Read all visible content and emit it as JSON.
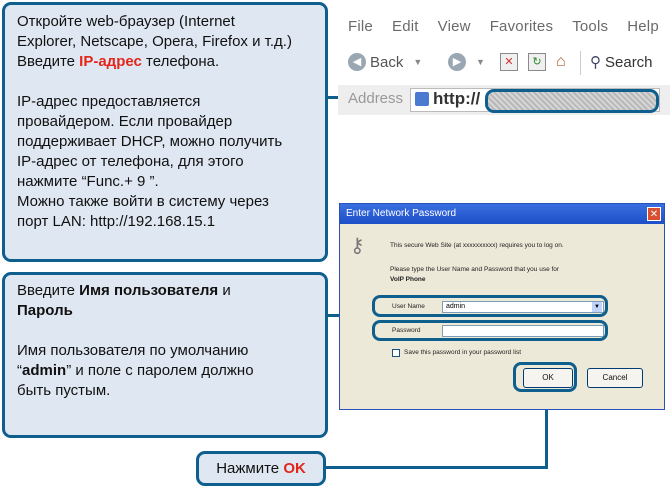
{
  "callouts": {
    "browser": {
      "line1": "Откройте web-браузер (Internet",
      "line2": "Explorer, Netscape, Opera, Firefox и т.д.)",
      "line3_pre": "Введите ",
      "line3_red": "IP-адрес",
      "line3_post": " телефона.",
      "p2_l1": "IP-адрес предоставляется",
      "p2_l2": "провайдером. Если провайдер",
      "p2_l3": "поддерживает DHCP,  можно получить",
      "p2_l4": "IP-адрес от телефона, для этого",
      "p2_l5": "нажмите “Func.+ 9 ”.",
      "p2_l6": "Можно также войти в систему через",
      "p2_l7": "порт LAN:  http://192.168.15.1"
    },
    "credentials": {
      "l1_pre": "Введите ",
      "l1_bold": "Имя пользователя",
      "l1_post": " и",
      "l2_bold": "Пароль",
      "p2_l1": "Имя пользователя по умолчанию",
      "p2_l2_pre": "“",
      "p2_l2_bold": "admin",
      "p2_l2_post": "” и поле с паролем должно",
      "p2_l3": "быть пустым."
    },
    "ok": {
      "pre": "Нажмите ",
      "red": "OK"
    }
  },
  "browser": {
    "menu": [
      "File",
      "Edit",
      "View",
      "Favorites",
      "Tools",
      "Help"
    ],
    "toolbar": {
      "back": "Back",
      "search": "Search"
    },
    "address_label": "Address",
    "address_text": "http://"
  },
  "dialog": {
    "title": "Enter Network Password",
    "close": "✕",
    "msg1": "This secure Web Site (at xxxxxxxxxx) requires you to log on.",
    "msg2": "Please type the User Name and Password that you use for",
    "msg3": "VoIP Phone",
    "username_label": "User Name",
    "username_value": "admin",
    "password_label": "Password",
    "password_value": "",
    "save_label": "Save this password in your password list",
    "ok_label": "OK",
    "cancel_label": "Cancel"
  },
  "colors": {
    "accent": "#0f5f8e",
    "highlight_red": "#e3261b",
    "callout_bg": "#dfe8f2"
  }
}
